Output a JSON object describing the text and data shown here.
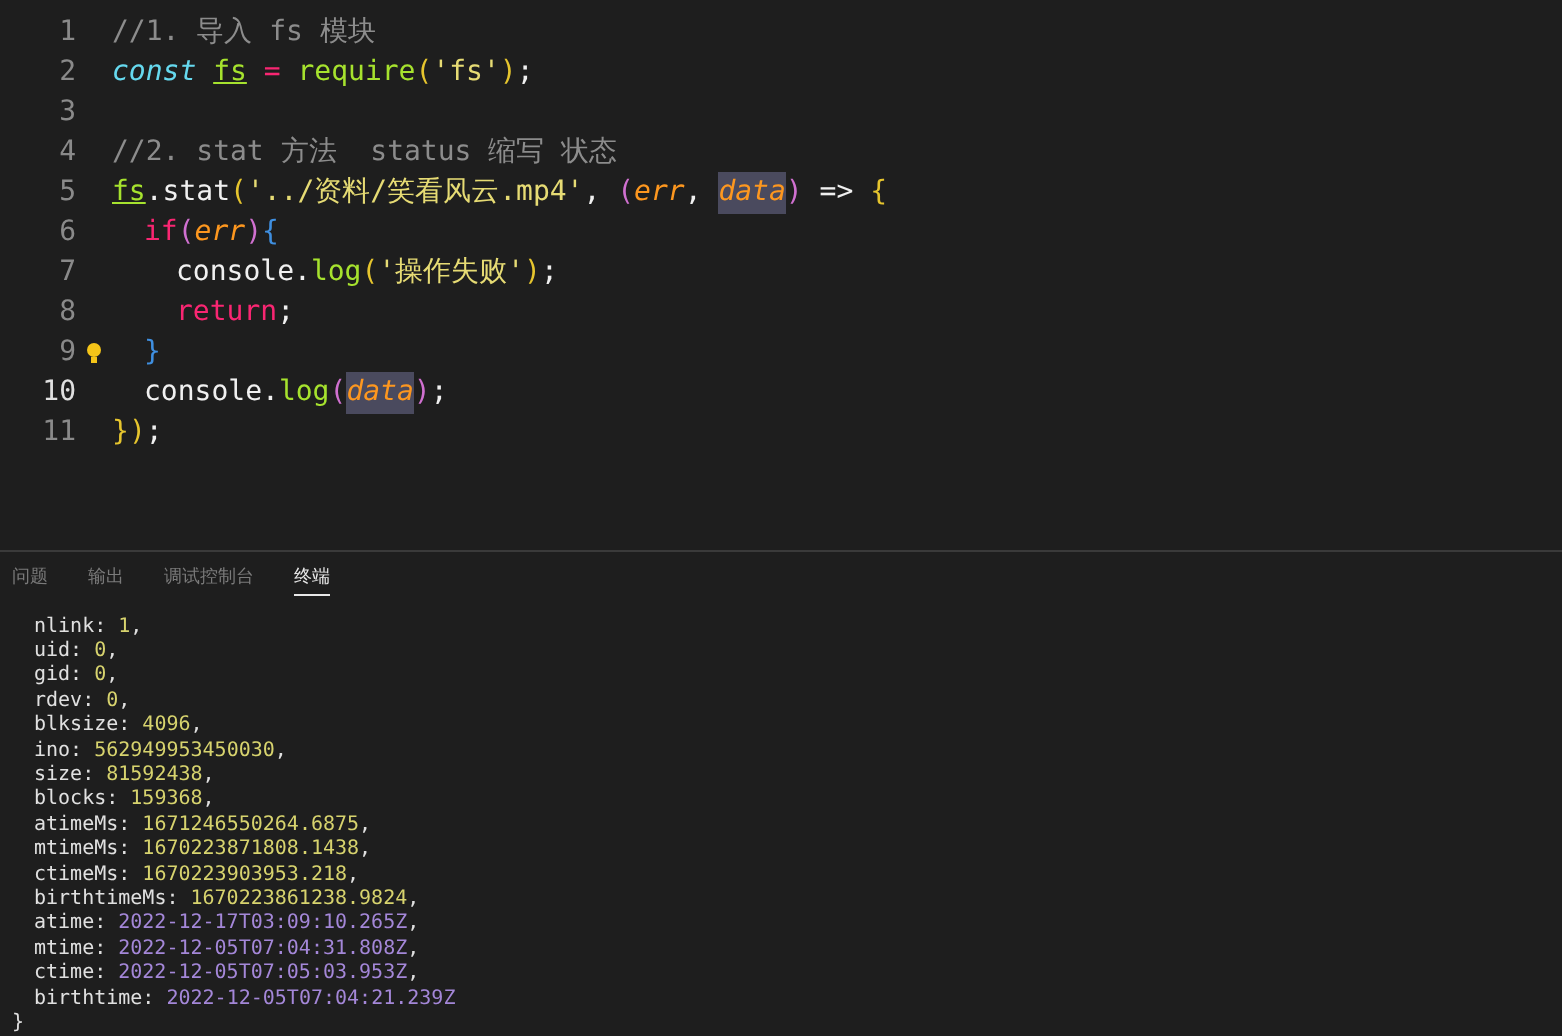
{
  "editor": {
    "lines": [
      {
        "number": "1",
        "current": false,
        "tokens": [
          {
            "text": "//1. 导入 fs 模块",
            "kind": "comment"
          }
        ]
      },
      {
        "number": "2",
        "current": false,
        "tokens": [
          {
            "text": "const ",
            "kind": "storage"
          },
          {
            "text": "fs",
            "kind": "var"
          },
          {
            "text": " = ",
            "kind": "keyword"
          },
          {
            "text": "require",
            "kind": "func"
          },
          {
            "text": "(",
            "kind": "paren"
          },
          {
            "text": "'fs'",
            "kind": "string"
          },
          {
            "text": ")",
            "kind": "paren"
          },
          {
            "text": ";",
            "kind": "plain"
          }
        ]
      },
      {
        "number": "3",
        "current": false
      },
      {
        "number": "4",
        "current": false,
        "tokens": [
          {
            "text": "//2. stat 方法  status 缩写 状态",
            "kind": "comment"
          }
        ]
      },
      {
        "number": "5",
        "current": false,
        "tokens": [
          {
            "text": "fs",
            "kind": "var"
          },
          {
            "text": ".stat",
            "kind": "plain"
          },
          {
            "text": "(",
            "kind": "paren"
          },
          {
            "text": "'../资料/笑看风云.mp4'",
            "kind": "string"
          },
          {
            "text": ", ",
            "kind": "plain"
          },
          {
            "text": "(",
            "kind": "paren2"
          },
          {
            "text": "err",
            "kind": "param"
          },
          {
            "text": ", ",
            "kind": "plain"
          },
          {
            "text": "data",
            "kind": "param",
            "highlighted": true
          },
          {
            "text": ")",
            "kind": "paren2"
          },
          {
            "text": " => ",
            "kind": "plain"
          },
          {
            "text": "{",
            "kind": "paren"
          }
        ],
        "children": [
          {
            "number": "6",
            "current": false,
            "tokens": [
              {
                "text": "if",
                "kind": "keyword"
              },
              {
                "text": "(",
                "kind": "paren2"
              },
              {
                "text": "err",
                "kind": "param"
              },
              {
                "text": ")",
                "kind": "paren2"
              },
              {
                "text": "{",
                "kind": "brace"
              }
            ],
            "children": [
              {
                "number": "7",
                "current": false,
                "tokens": [
                  {
                    "text": "console",
                    "kind": "plain"
                  },
                  {
                    "text": ".",
                    "kind": "plain"
                  },
                  {
                    "text": "log",
                    "kind": "func"
                  },
                  {
                    "text": "(",
                    "kind": "paren"
                  },
                  {
                    "text": "'操作失败'",
                    "kind": "string"
                  },
                  {
                    "text": ")",
                    "kind": "paren"
                  },
                  {
                    "text": ";",
                    "kind": "plain"
                  }
                ]
              },
              {
                "number": "8",
                "current": false,
                "tokens": [
                  {
                    "text": "return",
                    "kind": "keyword"
                  },
                  {
                    "text": ";",
                    "kind": "plain"
                  }
                ]
              }
            ]
          },
          {
            "number": "9",
            "current": false,
            "hint": true,
            "tokens": [
              {
                "text": "}",
                "kind": "brace"
              }
            ]
          },
          {
            "number": "10",
            "current": true,
            "tokens": [
              {
                "text": "console",
                "kind": "plain"
              },
              {
                "text": ".",
                "kind": "plain"
              },
              {
                "text": "log",
                "kind": "func"
              },
              {
                "text": "(",
                "kind": "paren2"
              },
              {
                "text": "data",
                "kind": "param",
                "highlighted": true
              },
              {
                "text": ")",
                "kind": "paren2"
              },
              {
                "text": ";",
                "kind": "plain"
              }
            ]
          }
        ]
      },
      {
        "number": "11",
        "current": false,
        "tokens": [
          {
            "text": "}",
            "kind": "paren"
          },
          {
            "text": ")",
            "kind": "paren"
          },
          {
            "text": ";",
            "kind": "plain"
          }
        ]
      }
    ]
  },
  "panel": {
    "tabs": [
      {
        "label": "问题",
        "selected": false
      },
      {
        "label": "输出",
        "selected": false
      },
      {
        "label": "调试控制台",
        "selected": false
      },
      {
        "label": "终端",
        "selected": true
      }
    ],
    "terminal": [
      {
        "key": "nlink:",
        "value": "1",
        "kind": "number",
        "tail": ","
      },
      {
        "key": "uid:",
        "value": "0",
        "kind": "number",
        "tail": ","
      },
      {
        "key": "gid:",
        "value": "0",
        "kind": "number",
        "tail": ","
      },
      {
        "key": "rdev:",
        "value": "0",
        "kind": "number",
        "tail": ","
      },
      {
        "key": "blksize:",
        "value": "4096",
        "kind": "number",
        "tail": ","
      },
      {
        "key": "ino:",
        "value": "562949953450030",
        "kind": "number",
        "tail": ","
      },
      {
        "key": "size:",
        "value": "81592438",
        "kind": "number",
        "tail": ","
      },
      {
        "key": "blocks:",
        "value": "159368",
        "kind": "number",
        "tail": ","
      },
      {
        "key": "atimeMs:",
        "value": "1671246550264.6875",
        "kind": "number",
        "tail": ","
      },
      {
        "key": "mtimeMs:",
        "value": "1670223871808.1438",
        "kind": "number",
        "tail": ","
      },
      {
        "key": "ctimeMs:",
        "value": "1670223903953.218",
        "kind": "number",
        "tail": ","
      },
      {
        "key": "birthtimeMs:",
        "value": "1670223861238.9824",
        "kind": "number",
        "tail": ","
      },
      {
        "key": "atime:",
        "value": "2022-12-17T03:09:10.265Z",
        "kind": "date",
        "tail": ","
      },
      {
        "key": "mtime:",
        "value": "2022-12-05T07:04:31.808Z",
        "kind": "date",
        "tail": ","
      },
      {
        "key": "ctime:",
        "value": "2022-12-05T07:05:03.953Z",
        "kind": "date",
        "tail": ","
      },
      {
        "key": "birthtime:",
        "value": "2022-12-05T07:04:21.239Z",
        "kind": "date"
      }
    ],
    "closing": "}"
  }
}
